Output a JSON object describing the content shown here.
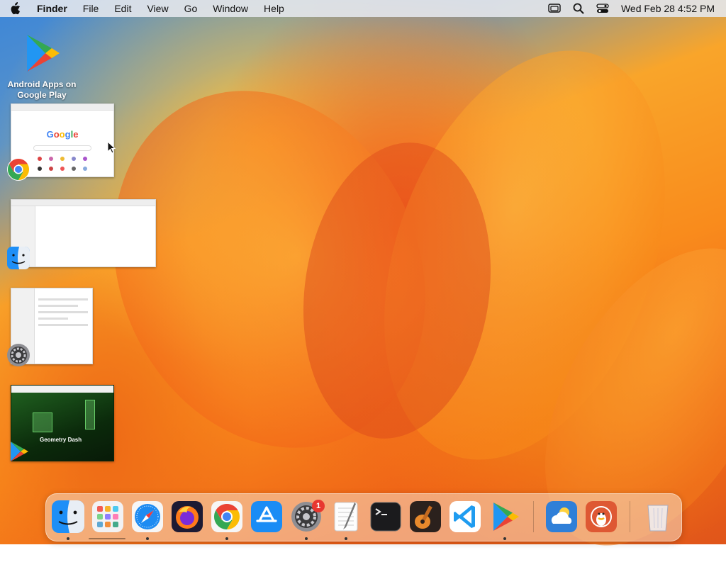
{
  "menubar": {
    "app_name": "Finder",
    "menus": [
      "File",
      "Edit",
      "View",
      "Go",
      "Window",
      "Help"
    ],
    "clock": "Wed Feb 28  4:52 PM",
    "status_icons": [
      "screen-mirroring-icon",
      "spotlight-search-icon",
      "control-center-icon"
    ]
  },
  "desktop": {
    "icons": [
      {
        "label": "Android Apps on Google Play",
        "icon": "google-play-icon"
      }
    ]
  },
  "windows_overview": [
    {
      "app": "Google Chrome",
      "icon": "chrome-icon",
      "content": "Google"
    },
    {
      "app": "Finder",
      "icon": "finder-icon"
    },
    {
      "app": "System Settings",
      "icon": "system-settings-icon"
    },
    {
      "app": "Google Play",
      "icon": "google-play-icon",
      "content": "Geometry Dash"
    }
  ],
  "dock": {
    "items": [
      {
        "name": "Finder",
        "icon": "finder-icon",
        "running": true
      },
      {
        "name": "Launchpad",
        "icon": "launchpad-icon",
        "running": false
      },
      {
        "name": "Safari",
        "icon": "safari-icon",
        "running": true
      },
      {
        "name": "Firefox",
        "icon": "firefox-icon",
        "running": false
      },
      {
        "name": "Google Chrome",
        "icon": "chrome-icon",
        "running": true
      },
      {
        "name": "App Store",
        "icon": "app-store-icon",
        "running": false
      },
      {
        "name": "System Settings",
        "icon": "system-settings-icon",
        "running": true,
        "badge": "1"
      },
      {
        "name": "TextEdit",
        "icon": "textedit-icon",
        "running": true
      },
      {
        "name": "Terminal",
        "icon": "terminal-icon",
        "running": false
      },
      {
        "name": "GarageBand",
        "icon": "garageband-icon",
        "running": false
      },
      {
        "name": "Visual Studio Code",
        "icon": "vscode-icon",
        "running": false
      },
      {
        "name": "Google Play",
        "icon": "google-play-icon",
        "running": true
      },
      {
        "name": "Weather",
        "icon": "weather-icon",
        "running": false
      },
      {
        "name": "DuckDuckGo",
        "icon": "duckduckgo-icon",
        "running": false
      },
      {
        "name": "Trash",
        "icon": "trash-icon",
        "running": false
      }
    ]
  }
}
